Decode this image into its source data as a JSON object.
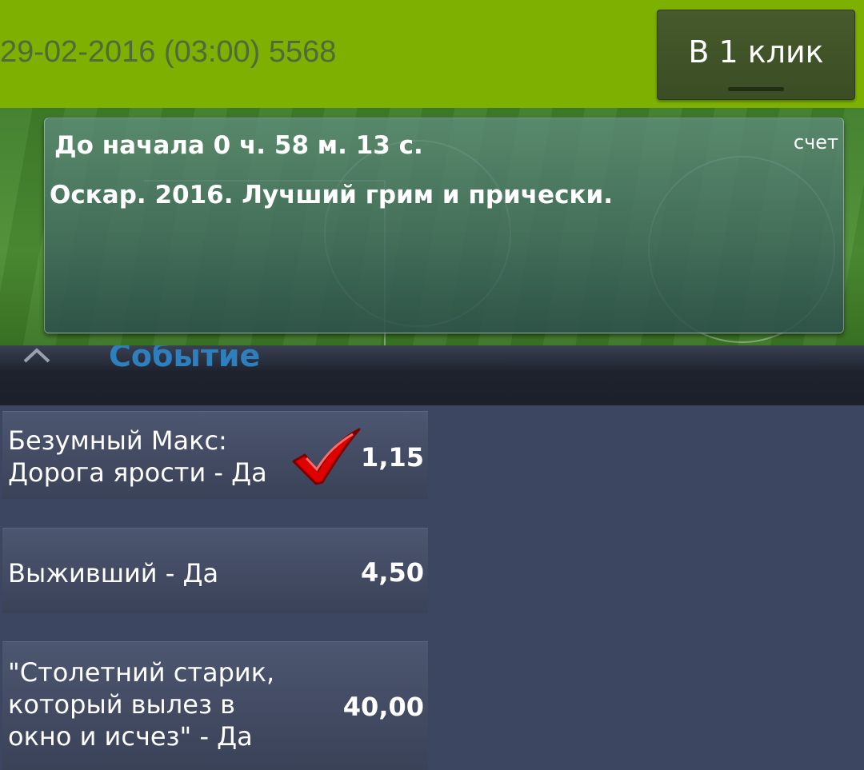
{
  "header": {
    "title": "29-02-2016 (03:00) 5568",
    "one_click_label": "В 1 клик"
  },
  "event": {
    "countdown": "До начала 0 ч. 58 м. 13 с.",
    "score_label": "счет",
    "title": "Оскар. 2016. Лучший грим и прически."
  },
  "section": {
    "label": "Событие",
    "collapse_icon": "chevron-up-icon"
  },
  "outcomes": [
    {
      "label": "Безумный Макс:\nДорога ярости - Да",
      "odds": "1,15",
      "selected": true,
      "icon": "checkmark-icon"
    },
    {
      "label": "Выживший - Да",
      "odds": "4,50",
      "selected": false
    },
    {
      "label": "\"Столетний старик,\nкоторый вылез в\nокно и исчез\" - Да",
      "odds": "40,00",
      "selected": false
    }
  ],
  "colors": {
    "header_bg": "#7db000",
    "page_bg": "#3d4660",
    "section_label": "#2d7fbe",
    "check": "#e00000"
  }
}
